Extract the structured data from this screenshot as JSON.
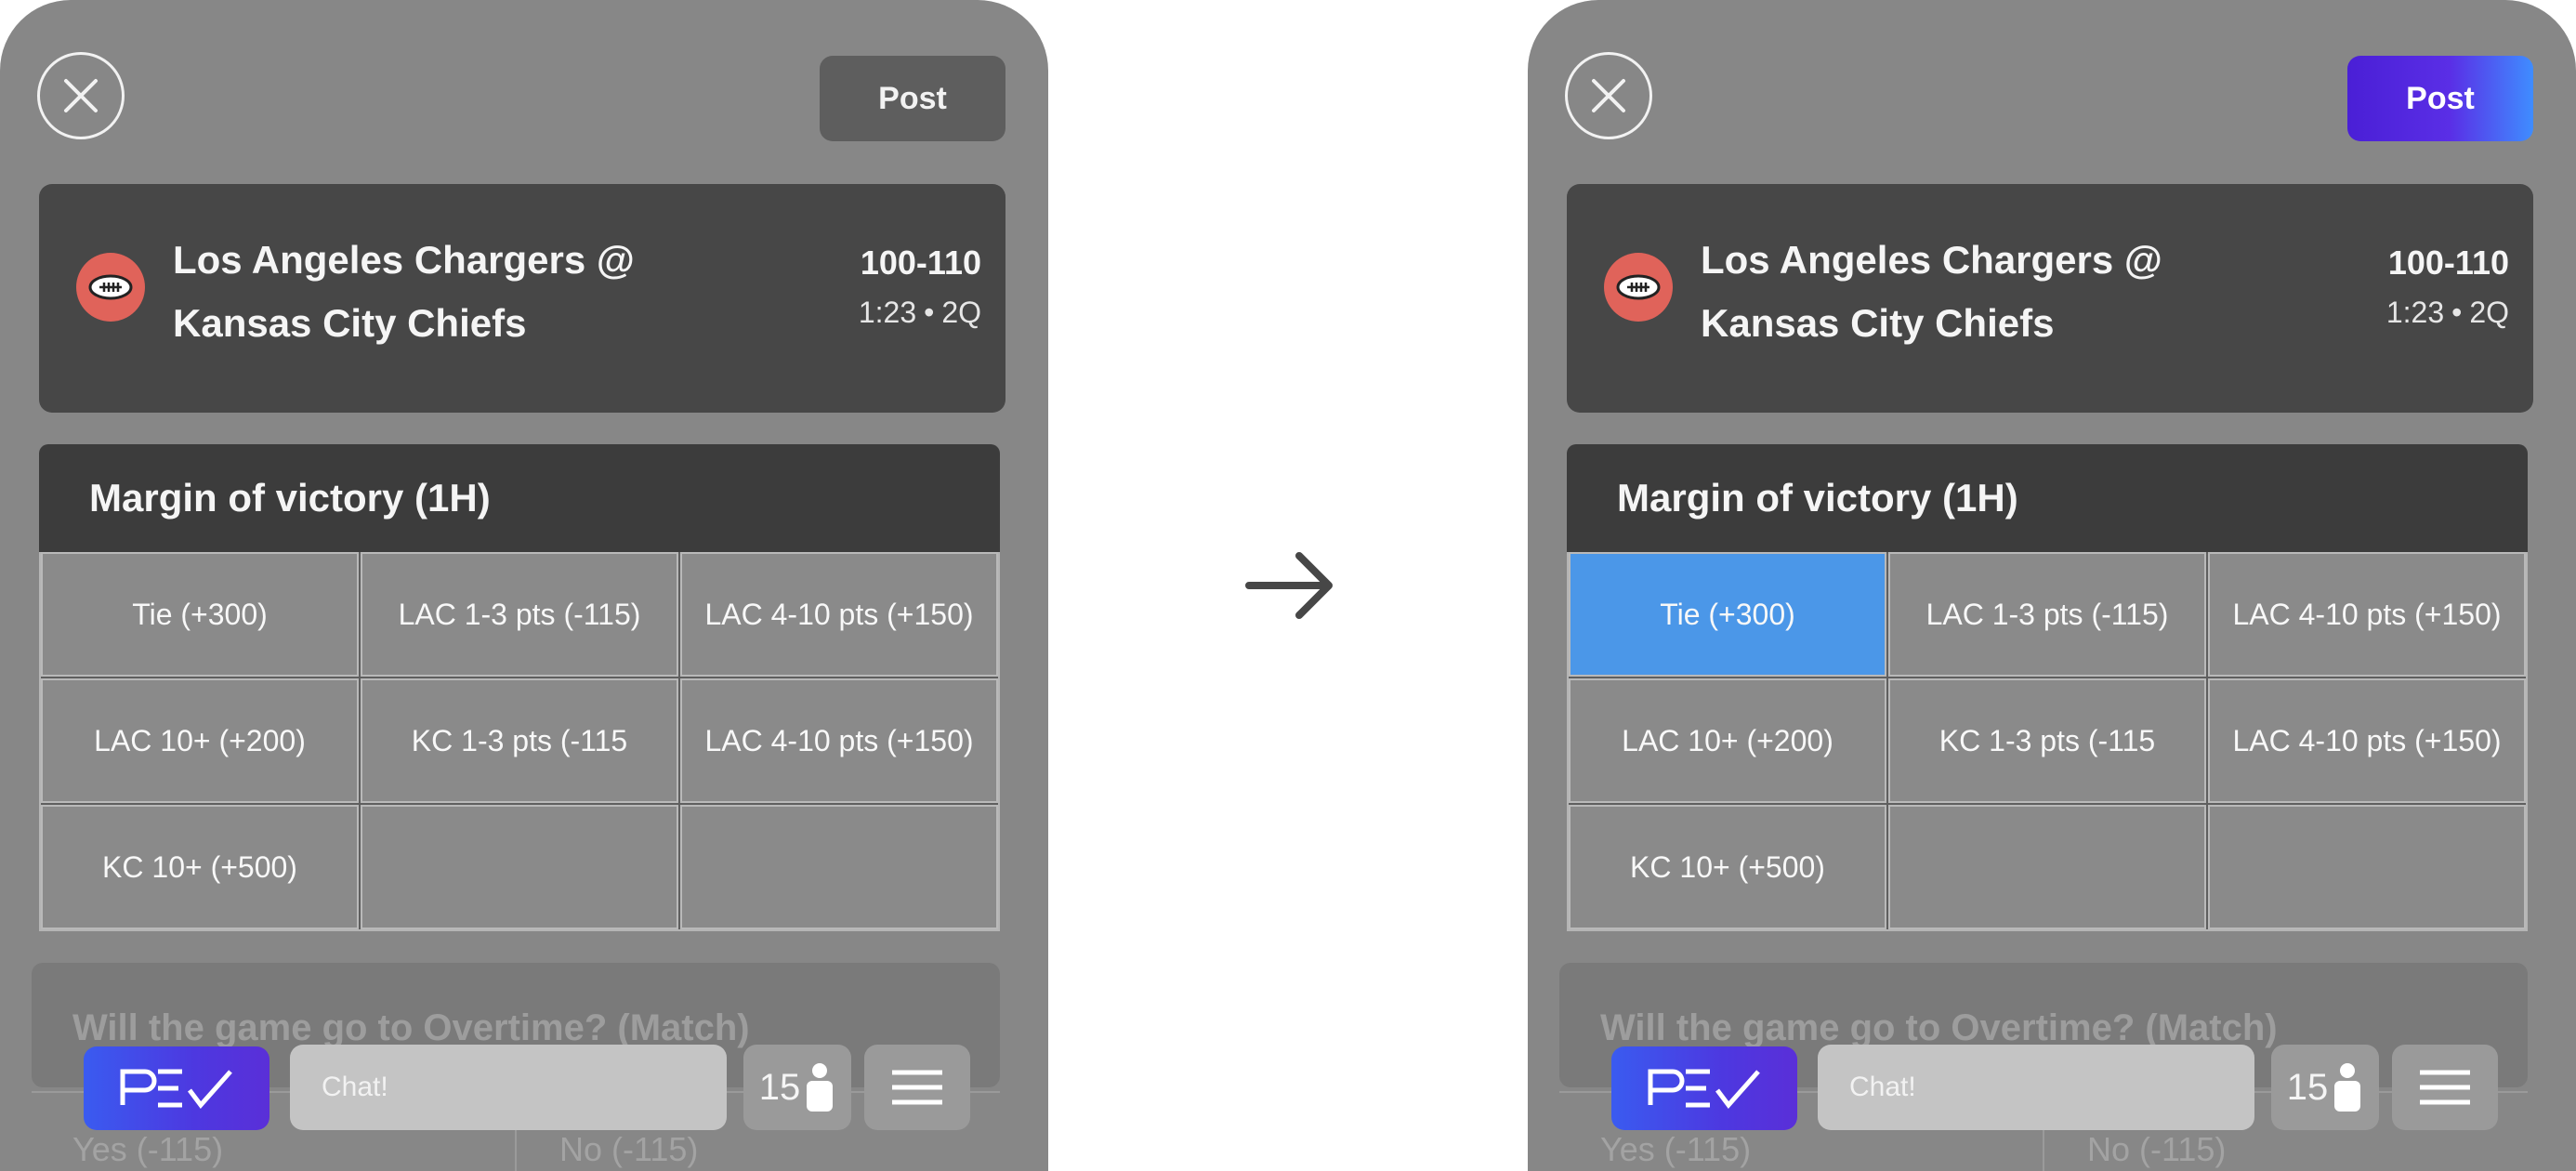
{
  "screens": {
    "before": {
      "post_label": "Post",
      "post_state": "inactive",
      "game": {
        "matchup_line1": "Los Angeles Chargers @",
        "matchup_line2": "Kansas City Chiefs",
        "score": "100-110",
        "time": "1:23",
        "separator": "•",
        "quarter": "2Q",
        "icon": "football-icon"
      },
      "market": {
        "title": "Margin of victory (1H)",
        "selected_index": null,
        "options": [
          "Tie (+300)",
          "LAC 1-3 pts (-115)",
          "LAC 4-10 pts (+150)",
          "LAC 10+ (+200)",
          "KC 1-3 pts (-115",
          "LAC 4-10 pts (+150)",
          "KC 10+ (+500)",
          "",
          ""
        ]
      },
      "market2": {
        "title": "Will the game go to Overtime? (Match)",
        "options": [
          "Yes (-115)",
          "No (-115)"
        ]
      },
      "bottom_bar": {
        "logo_text": "PE✓",
        "chat_placeholder": "Chat!",
        "count": "15",
        "menu_icon": "hamburger-menu-icon"
      }
    },
    "after": {
      "post_label": "Post",
      "post_state": "active",
      "game": {
        "matchup_line1": "Los Angeles Chargers @",
        "matchup_line2": "Kansas City Chiefs",
        "score": "100-110",
        "time": "1:23",
        "separator": "•",
        "quarter": "2Q",
        "icon": "football-icon"
      },
      "market": {
        "title": "Margin of victory (1H)",
        "selected_index": 0,
        "options": [
          "Tie (+300)",
          "LAC 1-3 pts (-115)",
          "LAC 4-10 pts (+150)",
          "LAC 10+ (+200)",
          "KC 1-3 pts (-115",
          "LAC 4-10 pts (+150)",
          "KC 10+ (+500)",
          "",
          ""
        ]
      },
      "market2": {
        "title": "Will the game go to Overtime? (Match)",
        "options": [
          "Yes (-115)",
          "No (-115)"
        ]
      },
      "bottom_bar": {
        "logo_text": "PE✓",
        "chat_placeholder": "Chat!",
        "count": "15",
        "menu_icon": "hamburger-menu-icon"
      }
    }
  },
  "transition_icon": "arrow-right-icon",
  "colors": {
    "phone_bg": "#878787",
    "card_bg": "#474747",
    "selected_cell": "#4b97e8",
    "post_active_gradient": [
      "#4a1fd6",
      "#3f8dff"
    ],
    "sport_icon_bg": "#e0635a"
  }
}
